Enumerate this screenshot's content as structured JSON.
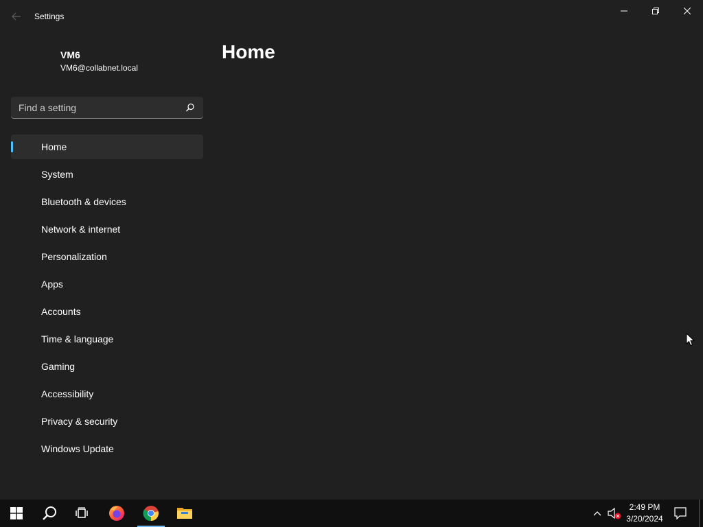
{
  "window": {
    "title": "Settings"
  },
  "user": {
    "name": "VM6",
    "email": "VM6@collabnet.local"
  },
  "search": {
    "placeholder": "Find a setting",
    "value": ""
  },
  "nav": {
    "items": [
      {
        "label": "Home",
        "selected": true
      },
      {
        "label": "System"
      },
      {
        "label": "Bluetooth & devices"
      },
      {
        "label": "Network & internet"
      },
      {
        "label": "Personalization"
      },
      {
        "label": "Apps"
      },
      {
        "label": "Accounts"
      },
      {
        "label": "Time & language"
      },
      {
        "label": "Gaming"
      },
      {
        "label": "Accessibility"
      },
      {
        "label": "Privacy & security"
      },
      {
        "label": "Windows Update"
      }
    ]
  },
  "main": {
    "title": "Home"
  },
  "taskbar": {
    "apps": [
      "start-icon",
      "search-icon",
      "task-view-icon",
      "firefox-icon",
      "chrome-icon",
      "file-explorer-icon"
    ],
    "active_app": "chrome-icon",
    "clock": {
      "time": "2:49 PM",
      "date": "3/20/2024"
    }
  },
  "colors": {
    "background": "#202020",
    "selected_item": "#2d2d2d",
    "accent": "#4cc2ff",
    "taskbar": "#101010"
  }
}
